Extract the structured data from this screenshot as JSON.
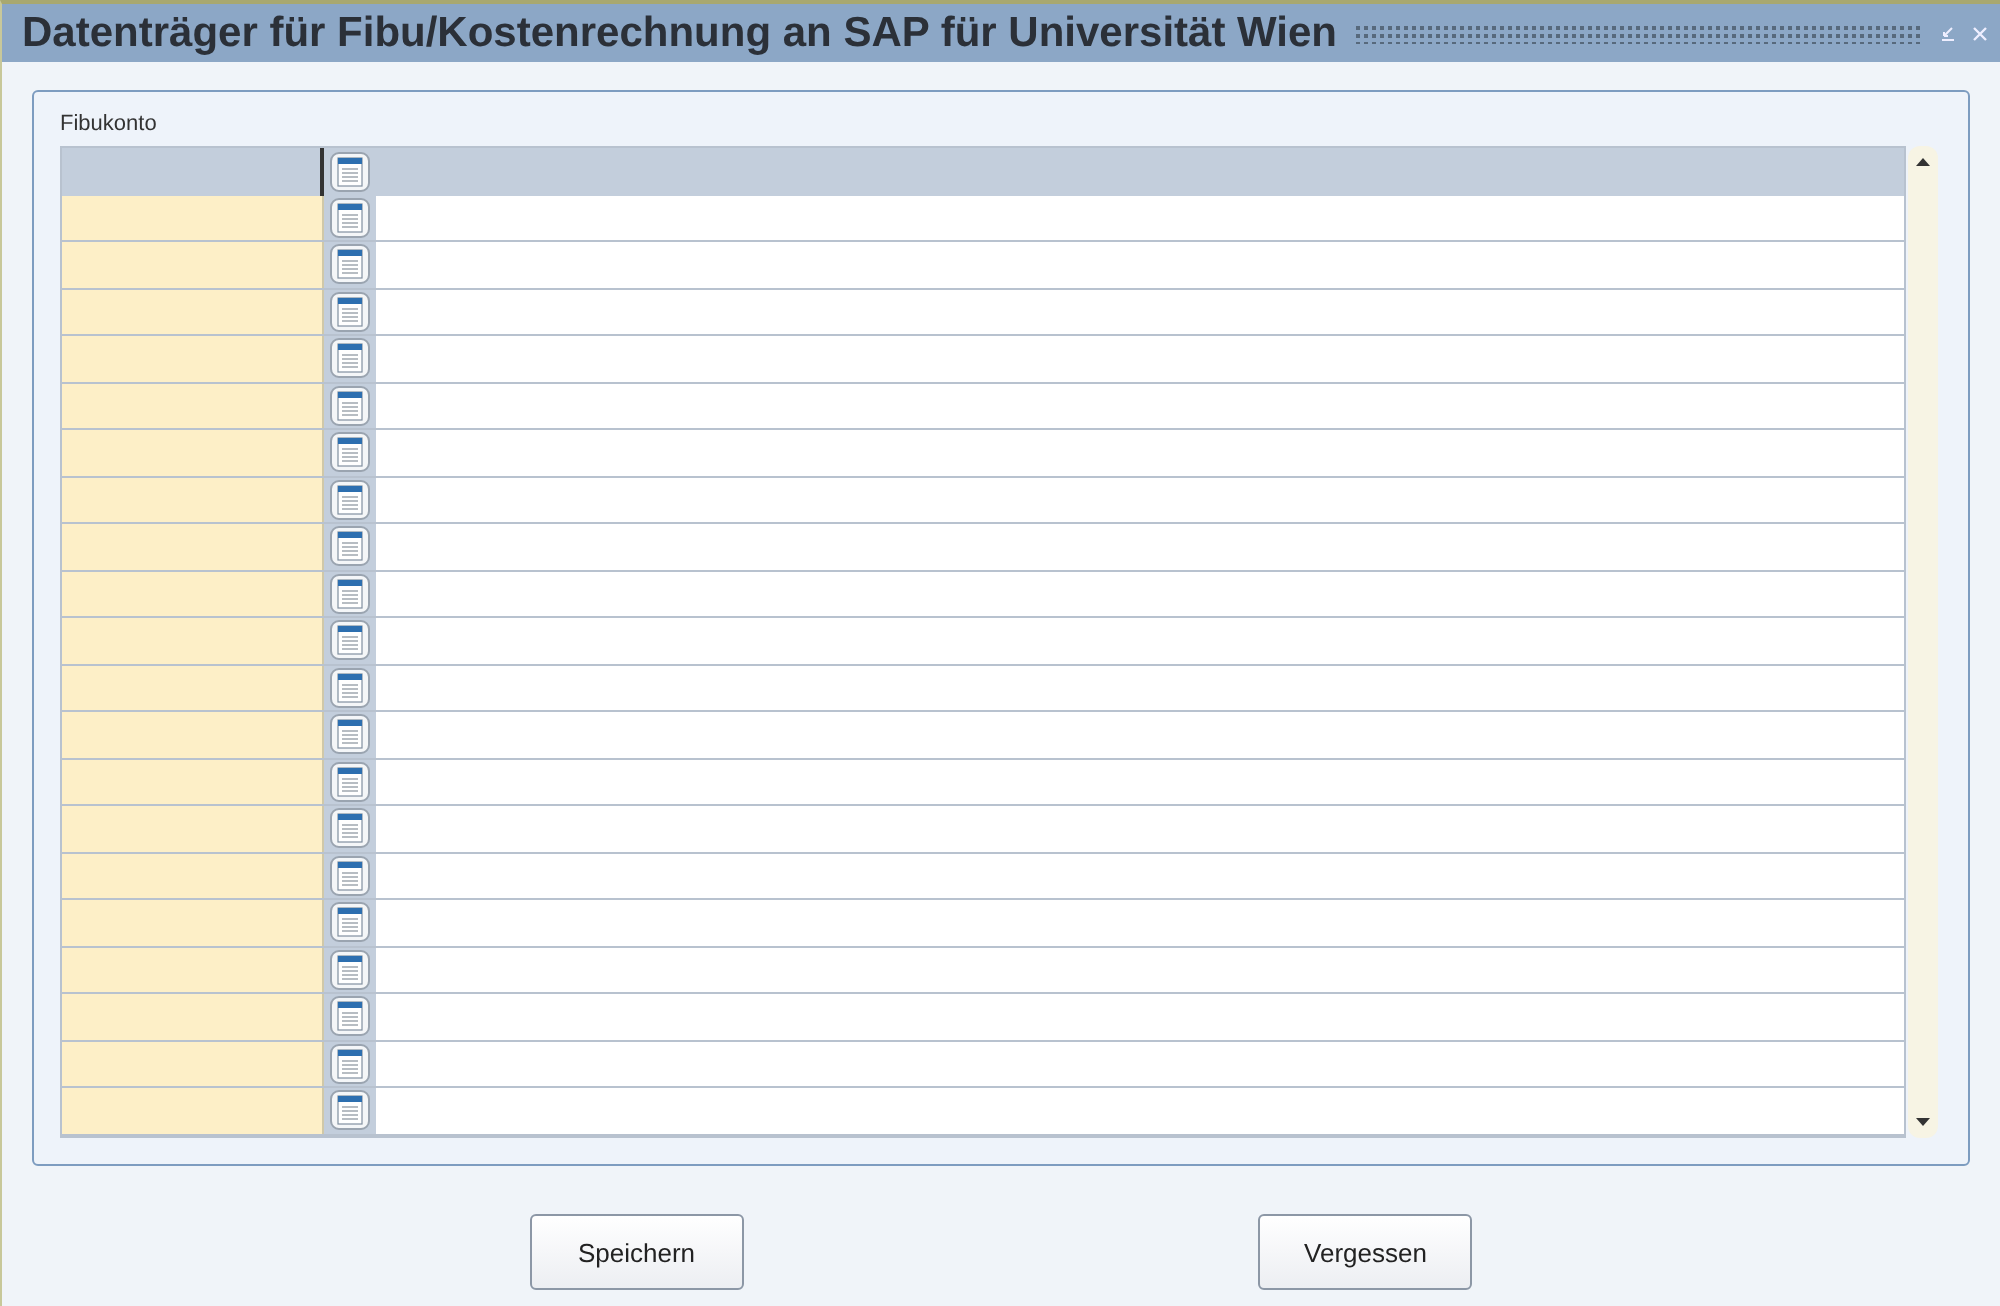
{
  "window": {
    "title": "Datenträger für Fibu/Kostenrechnung an SAP für Universität Wien"
  },
  "table": {
    "label": "Fibukonto"
  },
  "buttons": [
    {
      "label": "Speichern"
    },
    {
      "label": "Vergessen"
    }
  ]
}
